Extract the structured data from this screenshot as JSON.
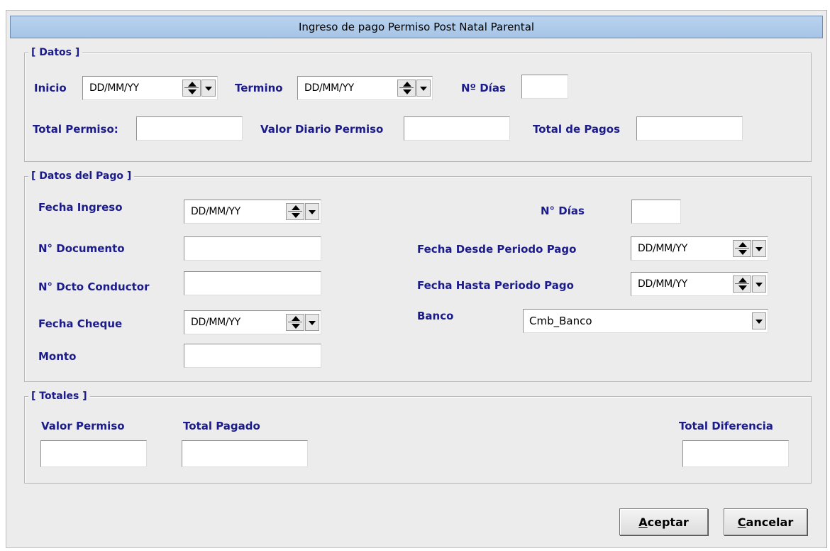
{
  "window": {
    "title": "Ingreso de pago Permiso Post Natal Parental"
  },
  "datos": {
    "legend": "[ Datos ]",
    "inicio_label": "Inicio",
    "inicio_value": "DD/MM/YY",
    "termino_label": "Termino",
    "termino_value": "DD/MM/YY",
    "n_dias_label": "Nº Días",
    "n_dias_value": "",
    "total_permiso_label": "Total Permiso:",
    "total_permiso_value": "",
    "valor_diario_label": "Valor Diario Permiso",
    "valor_diario_value": "",
    "total_pagos_label": "Total de Pagos",
    "total_pagos_value": ""
  },
  "datos_pago": {
    "legend": "[ Datos del Pago ]",
    "fecha_ingreso_label": "Fecha Ingreso",
    "fecha_ingreso_value": "DD/MM/YY",
    "n_documento_label": "N° Documento",
    "n_documento_value": "",
    "n_dcto_conductor_label": "N° Dcto Conductor",
    "n_dcto_conductor_value": "",
    "fecha_cheque_label": "Fecha Cheque",
    "fecha_cheque_value": "DD/MM/YY",
    "monto_label": "Monto",
    "monto_value": "",
    "n_dias_label": "N° Días",
    "n_dias_value": "",
    "fecha_desde_label": "Fecha Desde Periodo Pago",
    "fecha_desde_value": "DD/MM/YY",
    "fecha_hasta_label": "Fecha Hasta Periodo Pago",
    "fecha_hasta_value": "DD/MM/YY",
    "banco_label": "Banco",
    "banco_value": "Cmb_Banco"
  },
  "totales": {
    "legend": "[ Totales ]",
    "valor_permiso_label": "Valor Permiso",
    "valor_permiso_value": "",
    "total_pagado_label": "Total Pagado",
    "total_pagado_value": "",
    "total_diferencia_label": "Total Diferencia",
    "total_diferencia_value": ""
  },
  "buttons": {
    "aceptar_hotkey": "A",
    "aceptar_rest": "ceptar",
    "cancelar_hotkey": "C",
    "cancelar_rest": "ancelar"
  },
  "icons": {
    "spinner": "spin-up-down-icon",
    "dropdown": "chevron-down-icon"
  }
}
